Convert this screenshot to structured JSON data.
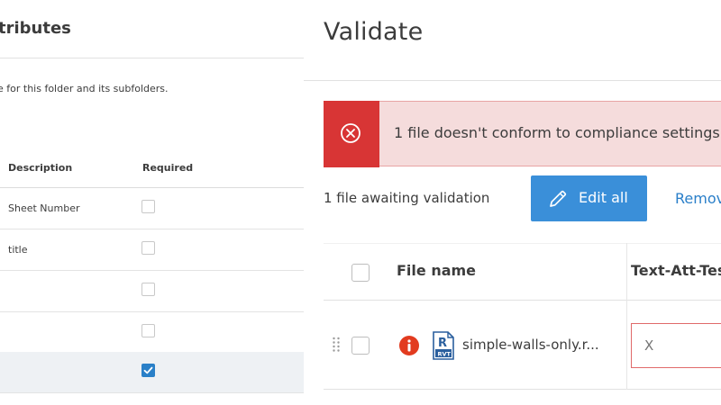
{
  "left_panel": {
    "title": "tributes",
    "note": "e for this folder and its subfolders.",
    "columns": {
      "description": "Description",
      "required": "Required"
    },
    "rows": [
      {
        "description": "Sheet Number",
        "required": false
      },
      {
        "description": "title",
        "required": false
      },
      {
        "description": "",
        "required": false
      },
      {
        "description": "",
        "required": false
      },
      {
        "description": "",
        "required": true
      }
    ]
  },
  "right_panel": {
    "title": "Validate",
    "alert": {
      "text": "1 file doesn't conform to compliance settings",
      "icon": "x-circle-icon",
      "color": "#d83535",
      "background": "#f5dcdc"
    },
    "awaiting_text": "1 file awaiting validation",
    "edit_button": {
      "label": "Edit all",
      "icon": "pencil-icon",
      "color": "#3a8fd9"
    },
    "remove_label": "Remov",
    "table": {
      "columns": {
        "file_name": "File name",
        "text_att": "Text-Att-Tes"
      },
      "rows": [
        {
          "file_name": "simple-walls-only.r...",
          "file_icon": "rvt-file-icon",
          "status_icon": "error-icon",
          "value_placeholder": "X"
        }
      ]
    }
  }
}
